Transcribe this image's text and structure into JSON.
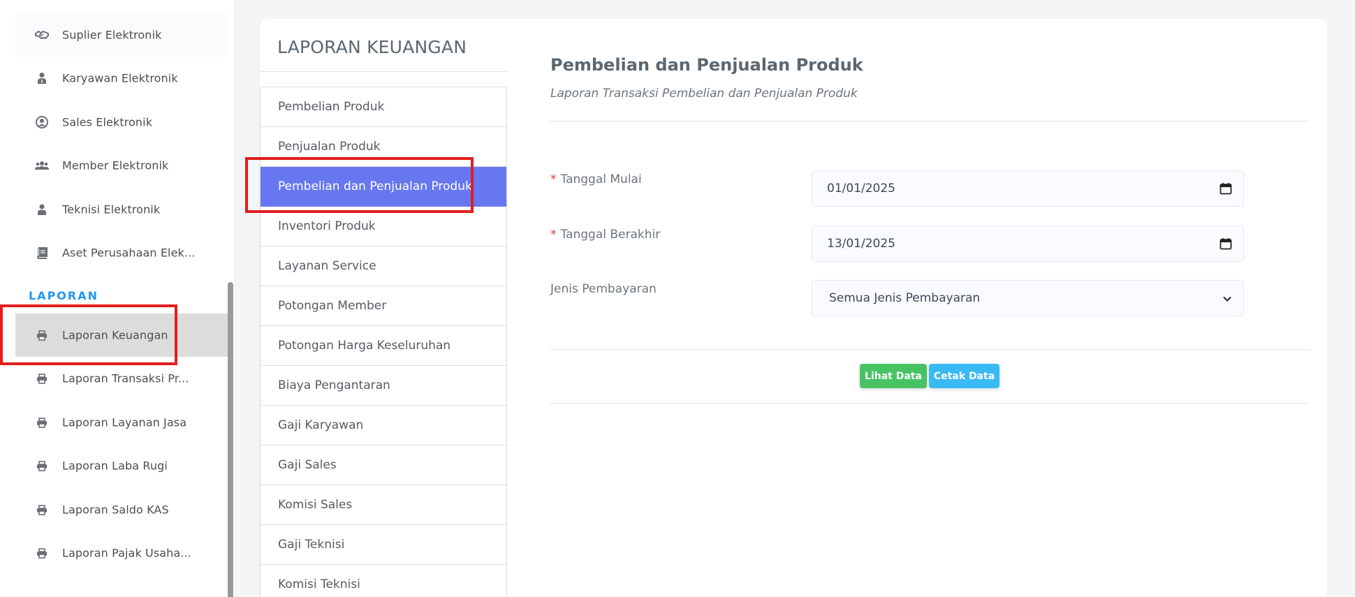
{
  "sidebar": {
    "items_top": [
      {
        "label": "Suplier Elektronik",
        "icon": "handshake-icon"
      },
      {
        "label": "Karyawan Elektronik",
        "icon": "user-tie-icon"
      },
      {
        "label": "Sales Elektronik",
        "icon": "user-circle-icon"
      },
      {
        "label": "Member Elektronik",
        "icon": "users-icon"
      },
      {
        "label": "Teknisi Elektronik",
        "icon": "user-icon"
      },
      {
        "label": "Aset Perusahaan Elek...",
        "icon": "book-icon"
      }
    ],
    "section_label": "LAPORAN",
    "items_laporan": [
      {
        "label": "Laporan Keuangan",
        "icon": "printer-icon",
        "active": true
      },
      {
        "label": "Laporan Transaksi Pr...",
        "icon": "printer-icon"
      },
      {
        "label": "Laporan Layanan Jasa",
        "icon": "printer-icon"
      },
      {
        "label": "Laporan Laba Rugi",
        "icon": "printer-icon"
      },
      {
        "label": "Laporan Saldo KAS",
        "icon": "printer-icon"
      },
      {
        "label": "Laporan Pajak Usaha...",
        "icon": "printer-icon"
      }
    ]
  },
  "card": {
    "title": "LAPORAN KEUANGAN",
    "report_list": [
      "Pembelian Produk",
      "Penjualan Produk",
      "Pembelian dan Penjualan Produk",
      "Inventori Produk",
      "Layanan Service",
      "Potongan Member",
      "Potongan Harga Keseluruhan",
      "Biaya Pengantaran",
      "Gaji Karyawan",
      "Gaji Sales",
      "Komisi Sales",
      "Gaji Teknisi",
      "Komisi Teknisi"
    ],
    "active_report": "Pembelian dan Penjualan Produk"
  },
  "content": {
    "title": "Pembelian dan Penjualan Produk",
    "subtitle": "Laporan Transaksi Pembelian dan Penjualan Produk",
    "form": {
      "required_mark": "*",
      "start_label": "Tanggal Mulai",
      "start_value": "01/01/2025",
      "end_label": "Tanggal Berakhir",
      "end_value": "13/01/2025",
      "payment_label": "Jenis Pembayaran",
      "payment_value": "Semua Jenis Pembayaran"
    },
    "buttons": {
      "view": "Lihat Data",
      "print": "Cetak Data"
    }
  },
  "colors": {
    "accent": "#6777ef",
    "success": "#47c363",
    "info": "#3abaf4",
    "section": "#2196f3",
    "highlight": "#e21d1d"
  }
}
